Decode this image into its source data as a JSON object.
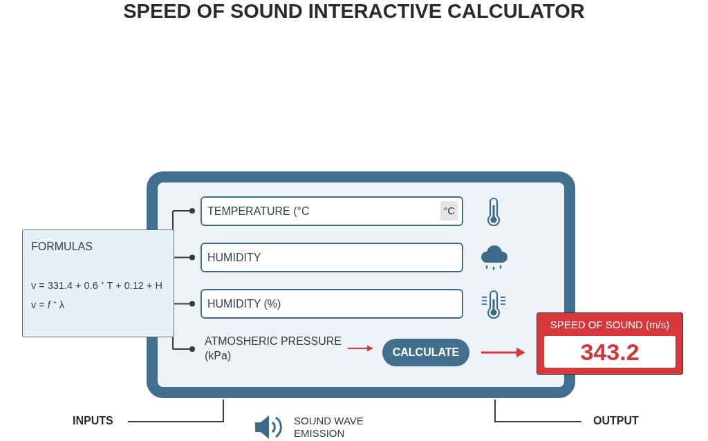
{
  "title": "SPEED OF SOUND INTERACTIVE CALCULATOR",
  "formulas": {
    "heading": "FORMULAS",
    "lines": [
      "v = 331.4 + 0.6 ⁺ T + 0.12 + H",
      "v = *f* ⁺ λ"
    ]
  },
  "fields": [
    {
      "placeholder": "TEMPERATURE (°C",
      "unit": "°C"
    },
    {
      "placeholder": "HUMIDITY"
    },
    {
      "placeholder": "HUMIDITY (%)"
    }
  ],
  "pressure_label": "ATMOSHERIC PRESSURE (kPa)",
  "button": "CALCULATE",
  "output": {
    "label": "SPEED OF SOUND (m/s)",
    "value": "343.2"
  },
  "annotations": {
    "inputs": "INPUTS",
    "sound": "SOUND WAVE EMISSION",
    "output": "OUTPUT"
  }
}
